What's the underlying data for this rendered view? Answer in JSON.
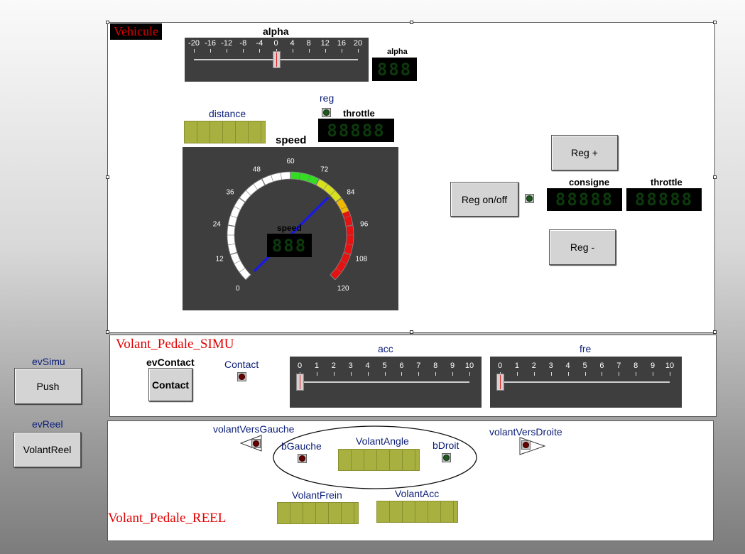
{
  "vehicule": {
    "title": "Vehicule",
    "alpha_slider": {
      "label": "alpha",
      "ticks": [
        "-20",
        "-16",
        "-12",
        "-8",
        "-4",
        "0",
        "4",
        "8",
        "12",
        "16",
        "20"
      ],
      "value": 0,
      "min": -20,
      "max": 20
    },
    "alpha_display": {
      "label": "alpha",
      "digits": "888"
    },
    "reg_label": "reg",
    "throttle_label": "throttle",
    "throttle_digits": "88888",
    "distance_label": "distance",
    "speed_title": "speed",
    "speed_gauge": {
      "ticks": [
        "0",
        "12",
        "24",
        "36",
        "48",
        "60",
        "72",
        "84",
        "96",
        "108",
        "120"
      ],
      "value": 0,
      "min": 0,
      "max": 120,
      "inner_label": "speed",
      "digits": "888"
    },
    "reg_plus": "Reg +",
    "reg_onoff": "Reg on/off",
    "reg_minus": "Reg -",
    "consigne_label": "consigne",
    "consigne_digits": "88888",
    "throttle2_label": "throttle",
    "throttle2_digits": "88888"
  },
  "simu": {
    "title": "Volant_Pedale_SIMU",
    "evcontact_label": "evContact",
    "contact_button": "Contact",
    "contact_led_label": "Contact",
    "acc": {
      "label": "acc",
      "ticks": [
        "0",
        "1",
        "2",
        "3",
        "4",
        "5",
        "6",
        "7",
        "8",
        "9",
        "10"
      ],
      "value": 0
    },
    "fre": {
      "label": "fre",
      "ticks": [
        "0",
        "1",
        "2",
        "3",
        "4",
        "5",
        "6",
        "7",
        "8",
        "9",
        "10"
      ],
      "value": 0
    }
  },
  "reel": {
    "title": "Volant_Pedale_REEL",
    "volant_vers_gauche": "volantVersGauche",
    "volant_vers_droite": "volantVersDroite",
    "bgauche": "bGauche",
    "bdroit": "bDroit",
    "volant_angle": "VolantAngle",
    "volant_frein": "VolantFrein",
    "volant_acc": "VolantAcc"
  },
  "side": {
    "evsimu_label": "evSimu",
    "push_button": "Push",
    "evreel_label": "evReel",
    "volantreel_button": "VolantReel"
  },
  "colors": {
    "led_off_red": "#6a0000",
    "led_off_green": "#1f5a1f",
    "needle": "#1a1ae0",
    "title_red": "#e00000"
  }
}
